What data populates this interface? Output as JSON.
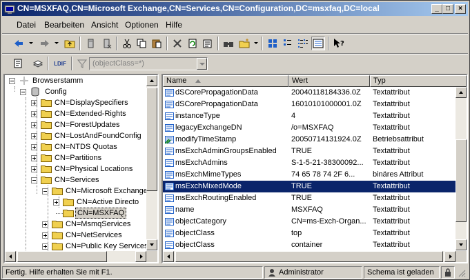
{
  "window": {
    "title": "CN=MSXFAQ,CN=Microsoft Exchange,CN=Services,CN=Configuration,DC=msxfaq,DC=local",
    "min_label": "_",
    "max_label": "□",
    "close_label": "×"
  },
  "menu": {
    "items": [
      {
        "label": "Datei"
      },
      {
        "label": "Bearbeiten"
      },
      {
        "label": "Ansicht"
      },
      {
        "label": "Optionen"
      },
      {
        "label": "Hilfe"
      }
    ]
  },
  "toolbar2": {
    "ldif_label": "LDIF",
    "filter_value": "(objectClass=*)"
  },
  "tree": {
    "root": "Browserstamm",
    "items": [
      {
        "label": "Config"
      },
      {
        "label": "CN=DisplaySpecifiers"
      },
      {
        "label": "CN=Extended-Rights"
      },
      {
        "label": "CN=ForestUpdates"
      },
      {
        "label": "CN=LostAndFoundConfig"
      },
      {
        "label": "CN=NTDS Quotas"
      },
      {
        "label": "CN=Partitions"
      },
      {
        "label": "CN=Physical Locations"
      },
      {
        "label": "CN=Services"
      },
      {
        "label": "CN=Microsoft Exchange"
      },
      {
        "label": "CN=Active Directo"
      },
      {
        "label": "CN=MSXFAQ"
      },
      {
        "label": "CN=MsmqServices"
      },
      {
        "label": "CN=NetServices"
      },
      {
        "label": "CN=Public Key Services"
      }
    ]
  },
  "list": {
    "columns": [
      {
        "label": "Name"
      },
      {
        "label": "Wert"
      },
      {
        "label": "Typ"
      }
    ],
    "rows": [
      {
        "name": "dSCorePropagationData",
        "value": "20040118184336.0Z",
        "type": "Textattribut"
      },
      {
        "name": "dSCorePropagationData",
        "value": "16010101000001.0Z",
        "type": "Textattribut"
      },
      {
        "name": "instanceType",
        "value": "4",
        "type": "Textattribut"
      },
      {
        "name": "legacyExchangeDN",
        "value": "/o=MSXFAQ",
        "type": "Textattribut"
      },
      {
        "name": "modifyTimeStamp",
        "value": "20050714131924.0Z",
        "type": "Betriebsattribut"
      },
      {
        "name": "msExchAdminGroupsEnabled",
        "value": "TRUE",
        "type": "Textattribut"
      },
      {
        "name": "msExchAdmins",
        "value": "S-1-5-21-38300092...",
        "type": "Textattribut"
      },
      {
        "name": "msExchMimeTypes",
        "value": "74 65 78 74 2F 6...",
        "type": "binäres Attribut"
      },
      {
        "name": "msExchMixedMode",
        "value": "TRUE",
        "type": "Textattribut"
      },
      {
        "name": "msExchRoutingEnabled",
        "value": "TRUE",
        "type": "Textattribut"
      },
      {
        "name": "name",
        "value": "MSXFAQ",
        "type": "Textattribut"
      },
      {
        "name": "objectCategory",
        "value": "CN=ms-Exch-Organ...",
        "type": "Textattribut"
      },
      {
        "name": "objectClass",
        "value": "top",
        "type": "Textattribut"
      },
      {
        "name": "objectClass",
        "value": "container",
        "type": "Textattribut"
      }
    ]
  },
  "status": {
    "message": "Fertig. Hilfe erhalten Sie mit F1.",
    "user": "Administrator",
    "schema": "Schema ist geladen"
  },
  "colors": {
    "titlebar_start": "#0a246a",
    "selection": "#0a246a",
    "face": "#d4d0c8"
  }
}
